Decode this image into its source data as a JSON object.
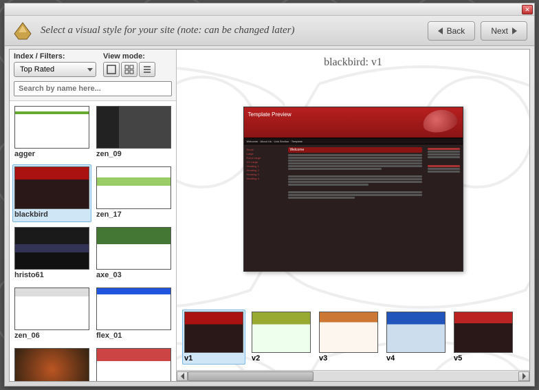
{
  "header": {
    "title": "Select a visual style for your site (note: can be changed later)",
    "back_label": "Back",
    "next_label": "Next"
  },
  "sidebar": {
    "filters_label": "Index / Filters:",
    "viewmode_label": "View mode:",
    "dropdown_value": "Top Rated",
    "search_placeholder": "Search by name here...",
    "templates": [
      {
        "name": "agger",
        "thumb_class": "t-agger",
        "selected": false
      },
      {
        "name": "zen_09",
        "thumb_class": "t-zen09",
        "selected": false
      },
      {
        "name": "blackbird",
        "thumb_class": "t-blackbird",
        "selected": true
      },
      {
        "name": "zen_17",
        "thumb_class": "t-zen17",
        "selected": false
      },
      {
        "name": "hristo61",
        "thumb_class": "t-hristo61",
        "selected": false
      },
      {
        "name": "axe_03",
        "thumb_class": "t-axe03",
        "selected": false
      },
      {
        "name": "zen_06",
        "thumb_class": "t-zen06",
        "selected": false
      },
      {
        "name": "flex_01",
        "thumb_class": "t-flex01",
        "selected": false
      },
      {
        "name": "",
        "thumb_class": "t-more1",
        "selected": false
      },
      {
        "name": "",
        "thumb_class": "t-more2",
        "selected": false
      }
    ]
  },
  "preview": {
    "title": "blackbird: v1",
    "banner_text": "Template Preview",
    "nav_text": "Welcome · About Us · Link Section · Template",
    "welcome_label": "Welcome",
    "side_items": [
      "Small",
      "Large",
      "Extra Large",
      "XX Large",
      "Heading 1",
      "Heading 2",
      "Heading 3",
      "Heading 4"
    ]
  },
  "variants": [
    {
      "label": "v1",
      "thumb_class": "v-v1",
      "selected": true
    },
    {
      "label": "v2",
      "thumb_class": "v-v2",
      "selected": false
    },
    {
      "label": "v3",
      "thumb_class": "v-v3",
      "selected": false
    },
    {
      "label": "v4",
      "thumb_class": "v-v4",
      "selected": false
    },
    {
      "label": "v5",
      "thumb_class": "v-v5",
      "selected": false
    }
  ]
}
